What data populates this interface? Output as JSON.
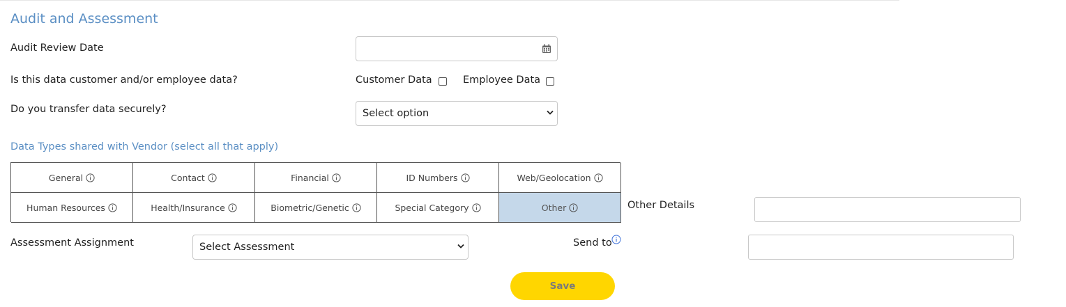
{
  "section": {
    "title": "Audit and Assessment"
  },
  "audit_review_date": {
    "label": "Audit Review Date",
    "value": ""
  },
  "data_kind": {
    "question": "Is this data customer and/or employee data?",
    "customer_label": "Customer Data",
    "employee_label": "Employee Data",
    "customer_checked": false,
    "employee_checked": false
  },
  "secure_transfer": {
    "question": "Do you transfer data securely?",
    "selected": "Select option"
  },
  "data_types": {
    "heading": "Data Types shared with Vendor (select all that apply)",
    "row1": [
      "General",
      "Contact",
      "Financial",
      "ID Numbers",
      "Web/Geolocation"
    ],
    "row2": [
      "Human Resources",
      "Health/Insurance",
      "Biometric/Genetic",
      "Special Category",
      "Other"
    ],
    "selected": "Other",
    "selected_color": "#c5d8ea"
  },
  "other_details": {
    "label": "Other Details",
    "value": ""
  },
  "assessment": {
    "label": "Assessment Assignment",
    "selected": "Select Assessment"
  },
  "send_to": {
    "label": "Send to",
    "value": ""
  },
  "save_button": {
    "label": "Save",
    "color": "#ffd600"
  },
  "icons": {
    "calendar": "calendar-icon",
    "info": "info-icon",
    "chevron": "chevron-down-icon"
  },
  "colors": {
    "accent": "#5b8fc4"
  }
}
